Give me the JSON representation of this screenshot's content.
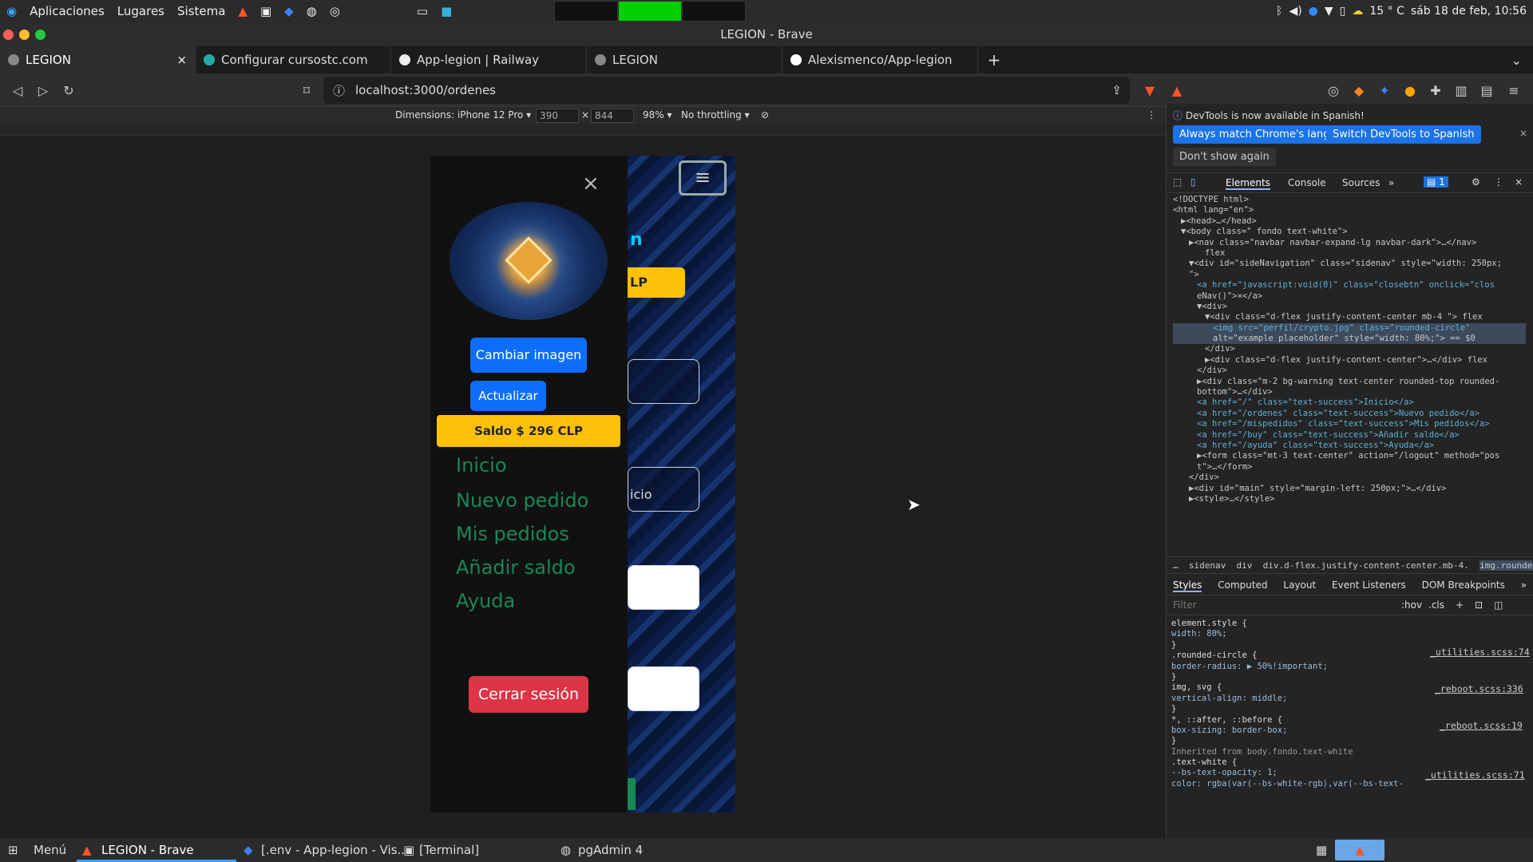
{
  "system_panel": {
    "menus": [
      "Aplicaciones",
      "Lugares",
      "Sistema"
    ],
    "weather": "15 ° C",
    "datetime": "sáb 18 de feb, 10:56"
  },
  "window": {
    "title": "LEGION - Brave"
  },
  "tabs": [
    {
      "label": "LEGION",
      "active": true
    },
    {
      "label": "Configurar cursostc.com"
    },
    {
      "label": "App-legion | Railway"
    },
    {
      "label": "LEGION"
    },
    {
      "label": "Alexismenco/App-legion"
    }
  ],
  "browser": {
    "url": "localhost:3000/ordenes"
  },
  "device_toolbar": {
    "dimensions_label": "Dimensions: iPhone 12 Pro ▾",
    "width": "390",
    "height": "844",
    "zoom": "98% ▾",
    "throttling": "No throttling ▾"
  },
  "app": {
    "close_symbol": "×",
    "change_image": "Cambiar imagen",
    "update": "Actualizar",
    "balance": "Saldo $ 296 CLP",
    "nav": [
      "Inicio",
      "Nuevo pedido",
      "Mis pedidos",
      "Añadir saldo",
      "Ayuda"
    ],
    "logout": "Cerrar sesión",
    "bg_partial": {
      "n": "n",
      "lp": "LP",
      "icio": "icio"
    }
  },
  "devtools": {
    "notice": "DevTools is now available in Spanish!",
    "btn_match": "Always match Chrome's language",
    "btn_switch": "Switch DevTools to Spanish",
    "btn_dont": "Don't show again",
    "tabs": [
      "Elements",
      "Console",
      "Sources",
      "»"
    ],
    "issues_badge": "1",
    "breadcrumb": [
      "…",
      "sidenav",
      "div",
      "div.d-flex.justify-content-center.mb-4.",
      "img.rounded-circle"
    ],
    "style_tabs": [
      "Styles",
      "Computed",
      "Layout",
      "Event Listeners",
      "DOM Breakpoints",
      "»"
    ],
    "filter_placeholder": "Filter",
    "hov": ":hov",
    "cls": ".cls",
    "dom": [
      "<!DOCTYPE html>",
      "<html lang=\"en\">",
      "▶<head>…</head>",
      "▼<body class=\" fondo text-white\">",
      "▶<nav class=\"navbar navbar-expand-lg navbar-dark\">…</nav>",
      "flex",
      "▼<div id=\"sideNavigation\" class=\"sidenav\" style=\"width: 250px;",
      "\">",
      "<a href=\"javascript:void(0)\" class=\"closebtn\" onclick=\"clos",
      "eNav()\">×</a>",
      "▼<div>",
      "▼<div class=\"d-flex justify-content-center mb-4 \"> flex",
      "<img src=\"perfil/crypto.jpg\" class=\"rounded-circle\"",
      "alt=\"example placeholder\" style=\"width: 80%;\"> == $0",
      "</div>",
      "▶<div class=\"d-flex justify-content-center\">…</div> flex",
      "</div>",
      "▶<div class=\"m-2 bg-warning text-center rounded-top rounded-",
      "bottom\">…</div>",
      "<a href=\"/\" class=\"text-success\">Inicio</a>",
      "<a href=\"/ordenes\" class=\"text-success\">Nuevo pedido</a>",
      "<a href=\"/mispedidos\" class=\"text-success\">Mis pedidos</a>",
      "<a href=\"/buy\" class=\"text-success\">Añadir saldo</a>",
      "<a href=\"/ayuda\" class=\"text-success\">Ayuda</a>",
      "▶<form class=\"mt-3 text-center\" action=\"/logout\" method=\"pos",
      "t\">…</form>",
      "</div>",
      "▶<div id=\"main\" style=\"margin-left: 250px;\">…</div>",
      "▶<style>…</style>"
    ],
    "styles": [
      "element.style {",
      "  width: 80%;",
      "}",
      ".rounded-circle {",
      "  border-radius: ▶ 50%!important;",
      "}",
      "img, svg {",
      "  vertical-align: middle;",
      "}",
      "*, ::after, ::before {",
      "  box-sizing: border-box;",
      "}",
      "Inherited from body.fondo.text-white",
      ".text-white {",
      "  --bs-text-opacity: 1;",
      "  color: rgba(var(--bs-white-rgb),var(--bs-text-"
    ],
    "style_sources": [
      "_utilities.scss:74",
      "_reboot.scss:336",
      "_reboot.scss:19",
      "_utilities.scss:71"
    ]
  },
  "taskbar": {
    "menu": "Menú",
    "items": [
      "LEGION - Brave",
      "[.env - App-legion - Vis...",
      "[Terminal]",
      "pgAdmin 4"
    ]
  },
  "colors": {
    "accent": "#0d6efd",
    "warning": "#ffc107",
    "success": "#198754",
    "danger": "#dc3545"
  }
}
